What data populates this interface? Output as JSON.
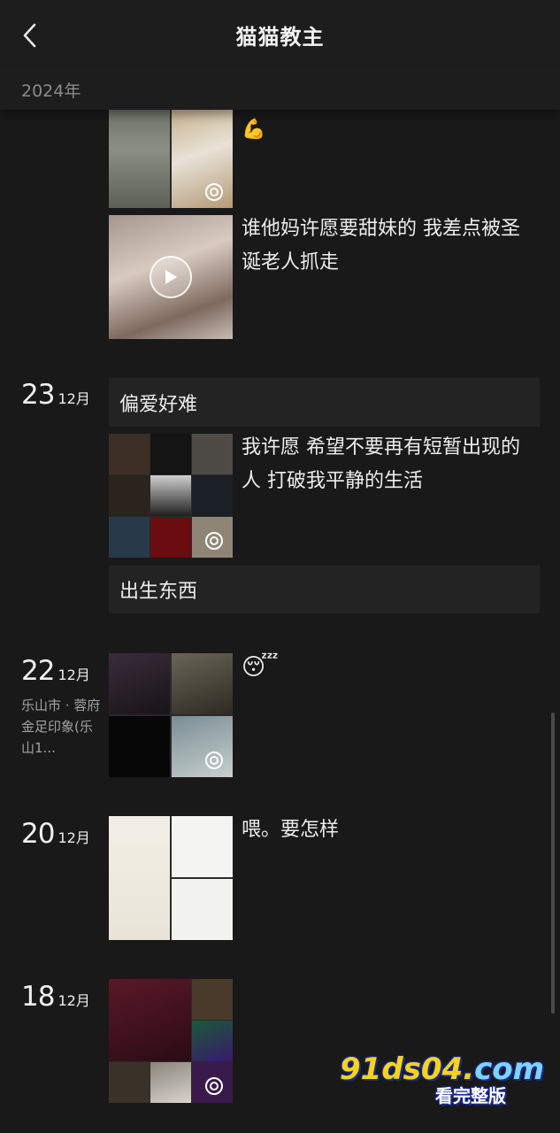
{
  "header": {
    "title": "猫猫教主",
    "back_icon": "chevron-left-icon"
  },
  "year_label": "2024年",
  "posts_top": {
    "caption_1": "💪",
    "caption_2": "谁他妈许愿要甜妹的 我差点被圣诞老人抓走"
  },
  "entries": [
    {
      "day": "23",
      "month": "12月",
      "text_card_1": "偏爱好难",
      "caption": "我许愿 希望不要再有短暂出现的人 打破我平静的生活",
      "text_card_2": "出生东西"
    },
    {
      "day": "22",
      "month": "12月",
      "location": "乐山市 · 蓉府金足印象(乐山1...",
      "caption": "😴"
    },
    {
      "day": "20",
      "month": "12月",
      "caption": "喂。要怎样"
    },
    {
      "day": "18",
      "month": "12月"
    }
  ],
  "colors": {
    "background": "#191919",
    "header": "#1d1d1d",
    "card": "#232323",
    "muted_text": "#8a8a8a"
  },
  "watermark": {
    "main": "91ds04.",
    "com": "com",
    "sub": "看完整版"
  }
}
